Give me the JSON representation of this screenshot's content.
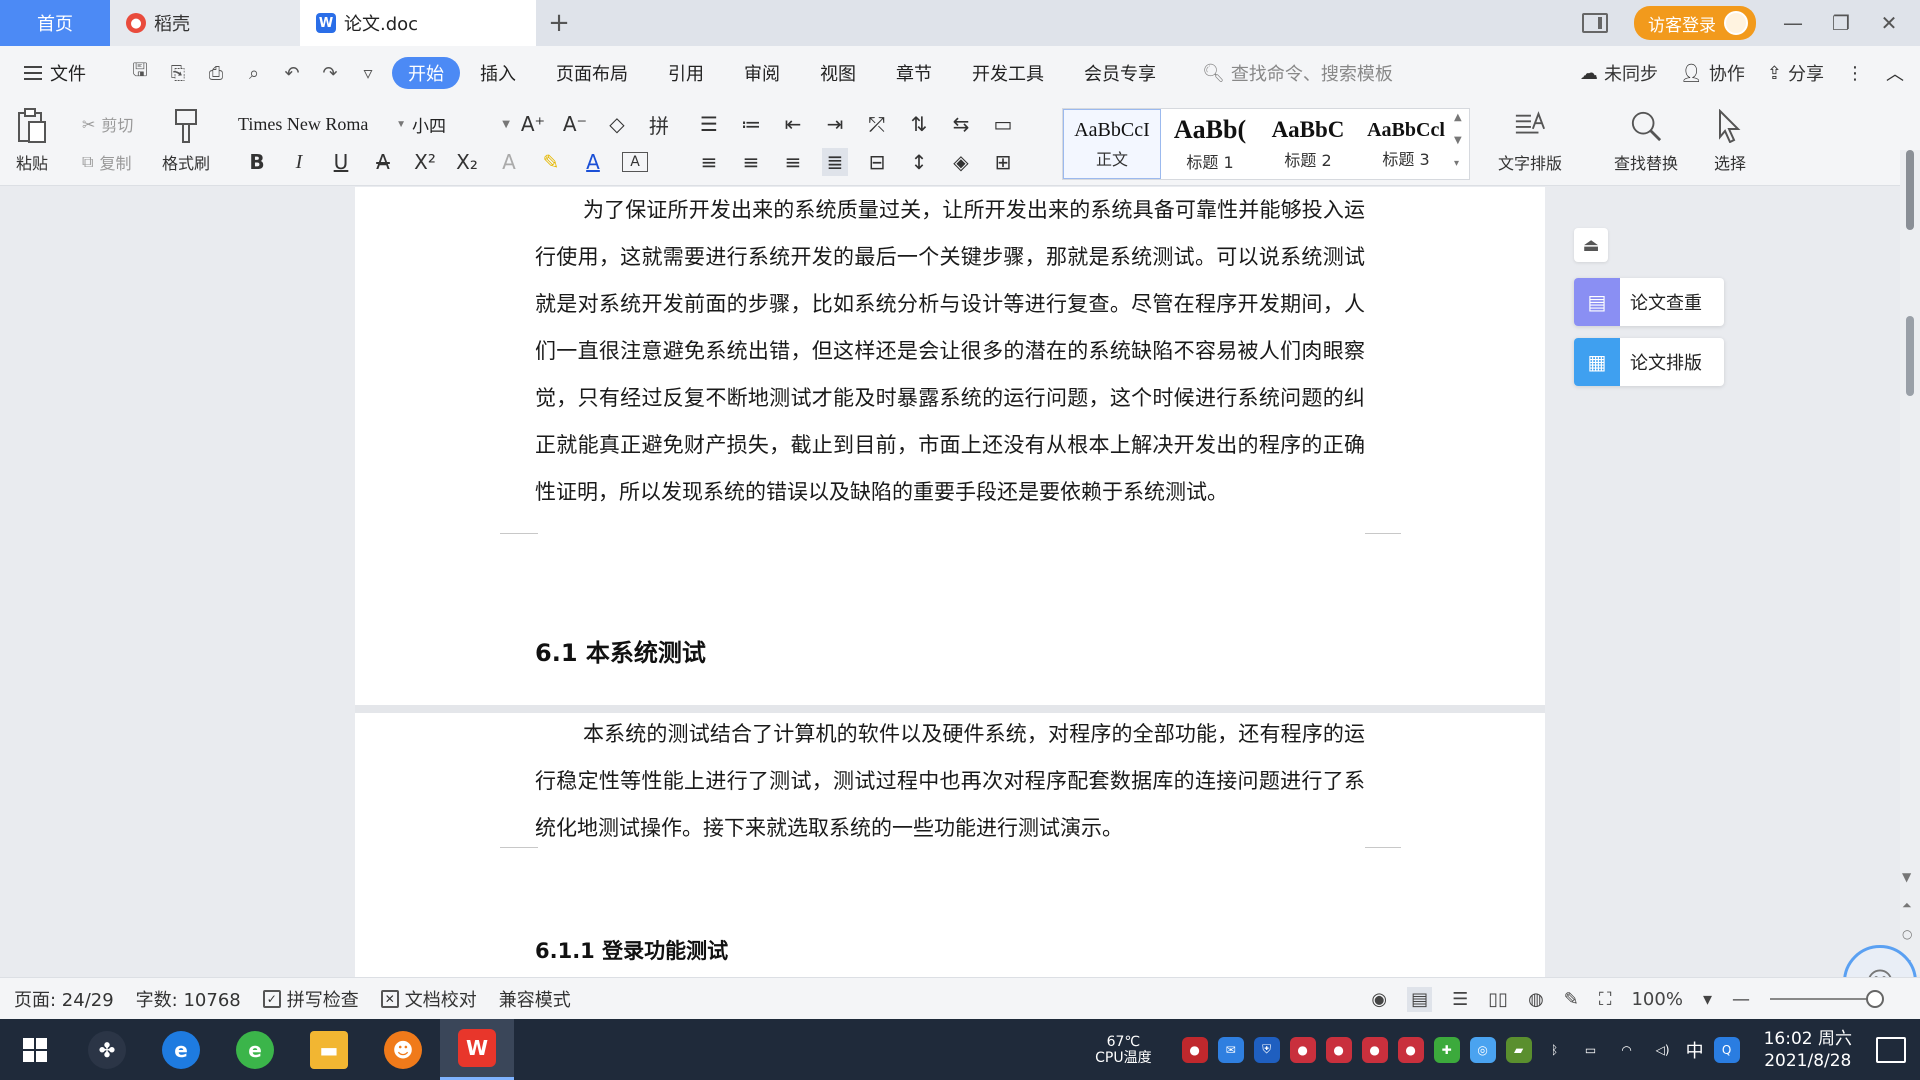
{
  "tabs": {
    "home": "首页",
    "docer": "稻壳",
    "doc": "论文.doc",
    "new": "+"
  },
  "titlebar": {
    "visitor_login": "访客登录"
  },
  "menu": {
    "file": "文件",
    "tabs": [
      "开始",
      "插入",
      "页面布局",
      "引用",
      "审阅",
      "视图",
      "章节",
      "开发工具",
      "会员专享"
    ],
    "search_placeholder": "查找命令、搜索模板",
    "right": {
      "sync": "未同步",
      "collab": "协作",
      "share": "分享"
    }
  },
  "ribbon": {
    "paste": "粘贴",
    "cut": "剪切",
    "copy": "复制",
    "format_painter": "格式刷",
    "font_name": "Times New Roma",
    "font_size": "小四",
    "styles": [
      {
        "preview": "AaBbCcI",
        "name": "正文"
      },
      {
        "preview": "AaBb(",
        "name": "标题 1"
      },
      {
        "preview": "AaBbC",
        "name": "标题 2"
      },
      {
        "preview": "AaBbCcl",
        "name": "标题 3"
      }
    ],
    "text_layout": "文字排版",
    "find_replace": "查找替换",
    "select": "选择"
  },
  "document": {
    "para1": "为了保证所开发出来的系统质量过关，让所开发出来的系统具备可靠性并能够投入运行使用，这就需要进行系统开发的最后一个关键步骤，那就是系统测试。可以说系统测试就是对系统开发前面的步骤，比如系统分析与设计等进行复查。尽管在程序开发期间，人们一直很注意避免系统出错，但这样还是会让很多的潜在的系统缺陷不容易被人们肉眼察觉，只有经过反复不断地测试才能及时暴露系统的运行问题，这个时候进行系统问题的纠正就能真正避免财产损失，截止到目前，市面上还没有从根本上解决开发出的程序的正确性证明，所以发现系统的错误以及缺陷的重要手段还是要依赖于系统测试。",
    "heading_61": "6.1  本系统测试",
    "para2": "本系统的测试结合了计算机的软件以及硬件系统，对程序的全部功能，还有程序的运行稳定性等性能上进行了测试，测试过程中也再次对程序配套数据库的连接问题进行了系统化地测试操作。接下来就选取系统的一些功能进行测试演示。",
    "heading_611": "6.1.1 登录功能测试"
  },
  "side_panel": {
    "plagiarism_check": "论文查重",
    "layout": "论文排版"
  },
  "statusbar": {
    "page": "页面: 24/29",
    "words": "字数: 10768",
    "spell_check": "拼写检查",
    "proofread": "文档校对",
    "compat": "兼容模式",
    "zoom": "100%"
  },
  "taskbar": {
    "cpu_temp": "67℃",
    "cpu_label": "CPU温度",
    "ime": "中",
    "time": "16:02 周六",
    "date": "2021/8/28"
  },
  "colors": {
    "accent": "#4c8af5",
    "visitor": "#f29a1c",
    "taskbar": "#1f2a3a"
  }
}
